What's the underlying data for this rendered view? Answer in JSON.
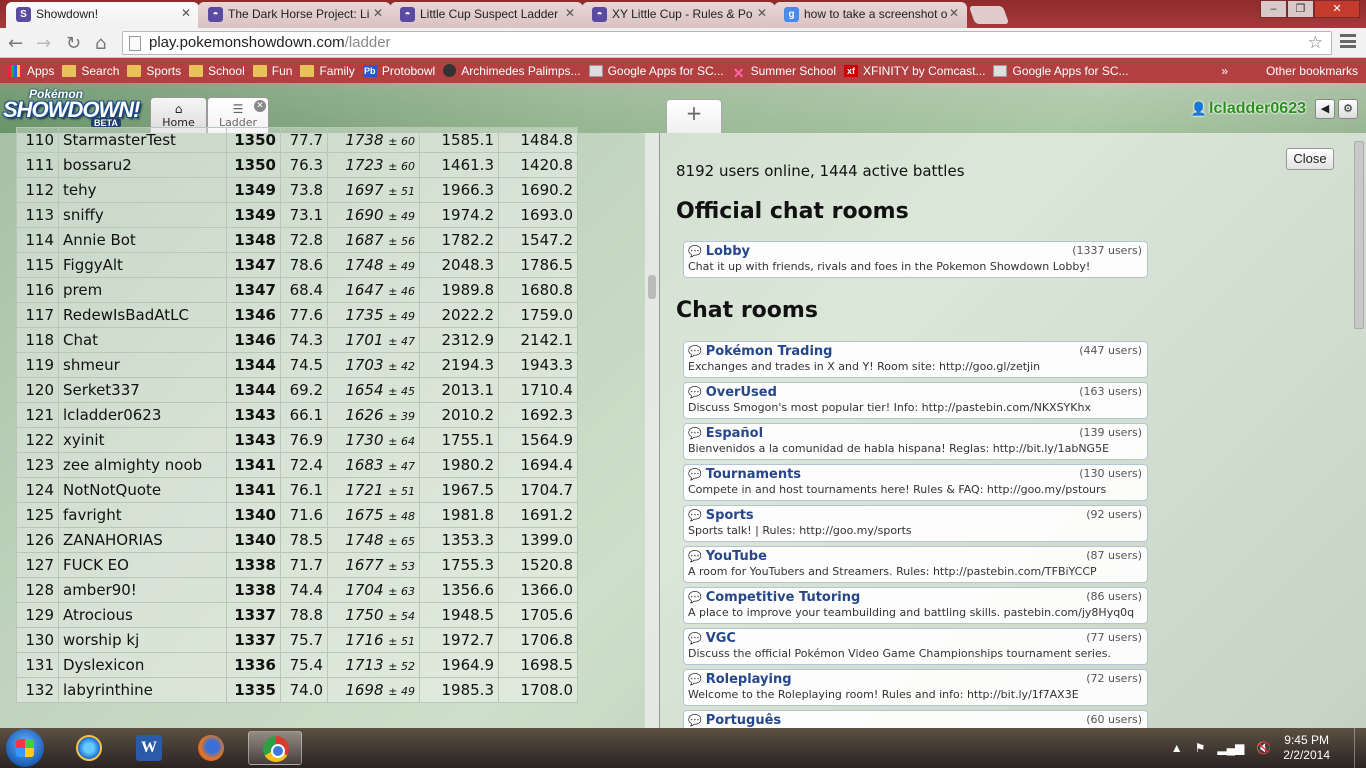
{
  "browser": {
    "tabs": [
      {
        "title": "Showdown!",
        "favicon": "S",
        "active": true
      },
      {
        "title": "The Dark Horse Project: Li",
        "favicon": "pokeball"
      },
      {
        "title": "Little Cup Suspect Ladder",
        "favicon": "pokeball"
      },
      {
        "title": "XY Little Cup - Rules & Po",
        "favicon": "pokeball"
      },
      {
        "title": "how to take a screenshot o",
        "favicon": "g"
      }
    ],
    "url_host": "play.pokemonshowdown.com",
    "url_path": "/ladder",
    "bookmarks": [
      "Apps",
      "Search",
      "Sports",
      "School",
      "Fun",
      "Family",
      "Protobowl",
      "Archimedes Palimps...",
      "Google Apps for SC...",
      "Summer School",
      "XFINITY by Comcast...",
      "Google Apps for SC..."
    ],
    "bookmarks_overflow": "»",
    "other_bookmarks": "Other bookmarks"
  },
  "showdown": {
    "logo_top": "Pokémon",
    "logo_main": "SHOWDOWN!",
    "logo_beta": "BETA",
    "tabs": {
      "home": "Home",
      "ladder": "Ladder",
      "plus": "+"
    },
    "username": "lcladder0623"
  },
  "ladder": {
    "rows": [
      {
        "rank": "110",
        "name": "StarmasterTest",
        "elo": "1350",
        "gxe": "77.7",
        "glicko": "1738",
        "dev": "± 60",
        "c1": "1585.1",
        "c2": "1484.8"
      },
      {
        "rank": "111",
        "name": "bossaru2",
        "elo": "1350",
        "gxe": "76.3",
        "glicko": "1723",
        "dev": "± 60",
        "c1": "1461.3",
        "c2": "1420.8"
      },
      {
        "rank": "112",
        "name": "tehy",
        "elo": "1349",
        "gxe": "73.8",
        "glicko": "1697",
        "dev": "± 51",
        "c1": "1966.3",
        "c2": "1690.2"
      },
      {
        "rank": "113",
        "name": "sniffy",
        "elo": "1349",
        "gxe": "73.1",
        "glicko": "1690",
        "dev": "± 49",
        "c1": "1974.2",
        "c2": "1693.0"
      },
      {
        "rank": "114",
        "name": "Annie Bot",
        "elo": "1348",
        "gxe": "72.8",
        "glicko": "1687",
        "dev": "± 56",
        "c1": "1782.2",
        "c2": "1547.2"
      },
      {
        "rank": "115",
        "name": "FiggyAlt",
        "elo": "1347",
        "gxe": "78.6",
        "glicko": "1748",
        "dev": "± 49",
        "c1": "2048.3",
        "c2": "1786.5"
      },
      {
        "rank": "116",
        "name": "prem",
        "elo": "1347",
        "gxe": "68.4",
        "glicko": "1647",
        "dev": "± 46",
        "c1": "1989.8",
        "c2": "1680.8"
      },
      {
        "rank": "117",
        "name": "RedewIsBadAtLC",
        "elo": "1346",
        "gxe": "77.6",
        "glicko": "1735",
        "dev": "± 49",
        "c1": "2022.2",
        "c2": "1759.0"
      },
      {
        "rank": "118",
        "name": "Chat",
        "elo": "1346",
        "gxe": "74.3",
        "glicko": "1701",
        "dev": "± 47",
        "c1": "2312.9",
        "c2": "2142.1"
      },
      {
        "rank": "119",
        "name": "shmeur",
        "elo": "1344",
        "gxe": "74.5",
        "glicko": "1703",
        "dev": "± 42",
        "c1": "2194.3",
        "c2": "1943.3"
      },
      {
        "rank": "120",
        "name": "Serket337",
        "elo": "1344",
        "gxe": "69.2",
        "glicko": "1654",
        "dev": "± 45",
        "c1": "2013.1",
        "c2": "1710.4"
      },
      {
        "rank": "121",
        "name": "lcladder0623",
        "elo": "1343",
        "gxe": "66.1",
        "glicko": "1626",
        "dev": "± 39",
        "c1": "2010.2",
        "c2": "1692.3"
      },
      {
        "rank": "122",
        "name": "xyinit",
        "elo": "1343",
        "gxe": "76.9",
        "glicko": "1730",
        "dev": "± 64",
        "c1": "1755.1",
        "c2": "1564.9"
      },
      {
        "rank": "123",
        "name": "zee almighty noob",
        "elo": "1341",
        "gxe": "72.4",
        "glicko": "1683",
        "dev": "± 47",
        "c1": "1980.2",
        "c2": "1694.4"
      },
      {
        "rank": "124",
        "name": "NotNotQuote",
        "elo": "1341",
        "gxe": "76.1",
        "glicko": "1721",
        "dev": "± 51",
        "c1": "1967.5",
        "c2": "1704.7"
      },
      {
        "rank": "125",
        "name": "favright",
        "elo": "1340",
        "gxe": "71.6",
        "glicko": "1675",
        "dev": "± 48",
        "c1": "1981.8",
        "c2": "1691.2"
      },
      {
        "rank": "126",
        "name": "ZANAHORIAS",
        "elo": "1340",
        "gxe": "78.5",
        "glicko": "1748",
        "dev": "± 65",
        "c1": "1353.3",
        "c2": "1399.0"
      },
      {
        "rank": "127",
        "name": "FUCK EO",
        "elo": "1338",
        "gxe": "71.7",
        "glicko": "1677",
        "dev": "± 53",
        "c1": "1755.3",
        "c2": "1520.8"
      },
      {
        "rank": "128",
        "name": "amber90!",
        "elo": "1338",
        "gxe": "74.4",
        "glicko": "1704",
        "dev": "± 63",
        "c1": "1356.6",
        "c2": "1366.0"
      },
      {
        "rank": "129",
        "name": "Atrocious",
        "elo": "1337",
        "gxe": "78.8",
        "glicko": "1750",
        "dev": "± 54",
        "c1": "1948.5",
        "c2": "1705.6"
      },
      {
        "rank": "130",
        "name": "worship kj",
        "elo": "1337",
        "gxe": "75.7",
        "glicko": "1716",
        "dev": "± 51",
        "c1": "1972.7",
        "c2": "1706.8"
      },
      {
        "rank": "131",
        "name": "Dyslexicon",
        "elo": "1336",
        "gxe": "75.4",
        "glicko": "1713",
        "dev": "± 52",
        "c1": "1964.9",
        "c2": "1698.5"
      },
      {
        "rank": "132",
        "name": "labyrinthine",
        "elo": "1335",
        "gxe": "74.0",
        "glicko": "1698",
        "dev": "± 49",
        "c1": "1985.3",
        "c2": "1708.0"
      }
    ]
  },
  "rooms": {
    "close_label": "Close",
    "online": "8192 users online, 1444 active battles",
    "official_title": "Official chat rooms",
    "chat_title": "Chat rooms",
    "official": [
      {
        "name": "Lobby",
        "users": "(1337 users)",
        "desc": "Chat it up with friends, rivals and foes in the Pokemon Showdown Lobby!"
      }
    ],
    "list": [
      {
        "name": "Pokémon Trading",
        "users": "(447 users)",
        "desc": "Exchanges and trades in X and Y! Room site: http://goo.gl/zetjin"
      },
      {
        "name": "OverUsed",
        "users": "(163 users)",
        "desc": "Discuss Smogon's most popular tier! Info: http://pastebin.com/NKXSYKhx"
      },
      {
        "name": "Español",
        "users": "(139 users)",
        "desc": "Bienvenidos a la comunidad de habla hispana! Reglas: http://bit.ly/1abNG5E"
      },
      {
        "name": "Tournaments",
        "users": "(130 users)",
        "desc": "Compete in and host tournaments here! Rules & FAQ: http://goo.my/pstours"
      },
      {
        "name": "Sports",
        "users": "(92 users)",
        "desc": "Sports talk! | Rules: http://goo.my/sports"
      },
      {
        "name": "YouTube",
        "users": "(87 users)",
        "desc": "A room for YouTubers and Streamers. Rules: http://pastebin.com/TFBiYCCP"
      },
      {
        "name": "Competitive Tutoring",
        "users": "(86 users)",
        "desc": "A place to improve your teambuilding and battling skills. pastebin.com/jy8Hyq0q"
      },
      {
        "name": "VGC",
        "users": "(77 users)",
        "desc": "Discuss the official Pokémon Video Game Championships tournament series."
      },
      {
        "name": "Roleplaying",
        "users": "(72 users)",
        "desc": "Welcome to the Roleplaying room! Rules and info: http://bit.ly/1f7AX3E"
      },
      {
        "name": "Português",
        "users": "(60 users)",
        "desc": ""
      }
    ]
  },
  "taskbar": {
    "time": "9:45 PM",
    "date": "2/2/2014"
  }
}
